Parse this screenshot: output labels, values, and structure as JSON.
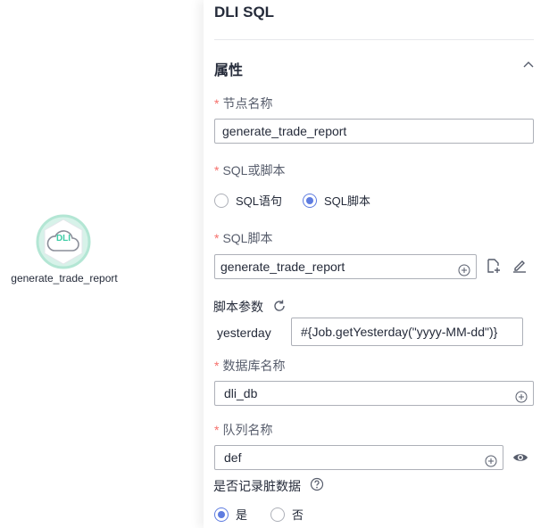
{
  "canvas": {
    "node": {
      "label": "generate_trade_report",
      "icon_text": "DLI",
      "icon": "cloud-icon"
    }
  },
  "panel": {
    "title": "DLI SQL",
    "section_title": "属性",
    "fields": {
      "node_name": {
        "label": "节点名称",
        "value": "generate_trade_report"
      },
      "sql_or_script": {
        "label": "SQL或脚本",
        "options": [
          "SQL语句",
          "SQL脚本"
        ],
        "selected": "SQL脚本"
      },
      "sql_script": {
        "label": "SQL脚本",
        "value": "generate_trade_report"
      },
      "script_params": {
        "label": "脚本参数",
        "param_name": "yesterday",
        "param_value": "#{Job.getYesterday(\"yyyy-MM-dd\")}"
      },
      "database_name": {
        "label": "数据库名称",
        "value": "dli_db"
      },
      "queue_name": {
        "label": "队列名称",
        "value": "def"
      },
      "record_dirty_data": {
        "label": "是否记录脏数据",
        "options": [
          "是",
          "否"
        ],
        "selected": "是"
      }
    },
    "required_mark": "*"
  },
  "colors": {
    "accent": "#5e7ce0",
    "required": "#f66f6a",
    "node_ring": "#b3e6d4",
    "node_icon": "#3dcca6"
  }
}
